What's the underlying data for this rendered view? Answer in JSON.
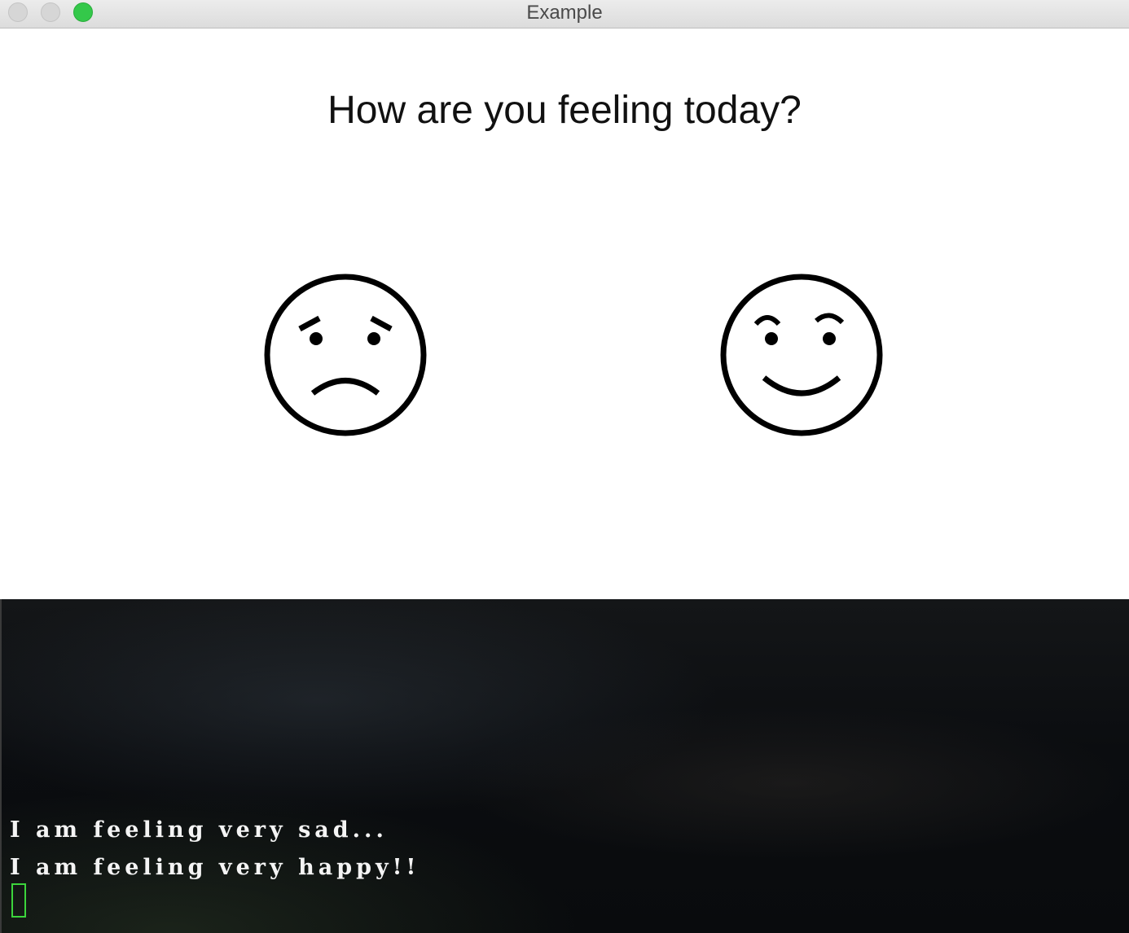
{
  "window": {
    "title": "Example",
    "controls": [
      "close",
      "minimize",
      "zoom"
    ],
    "zoom_color": "#34c84a"
  },
  "main": {
    "prompt": "How are you feeling today?",
    "buttons": [
      {
        "id": "sad",
        "icon": "sad-face-icon"
      },
      {
        "id": "happy",
        "icon": "happy-face-icon"
      }
    ]
  },
  "terminal": {
    "lines": [
      "I am feeling very sad...",
      "I am feeling very happy!!"
    ],
    "cursor_color": "#3cd43c"
  }
}
